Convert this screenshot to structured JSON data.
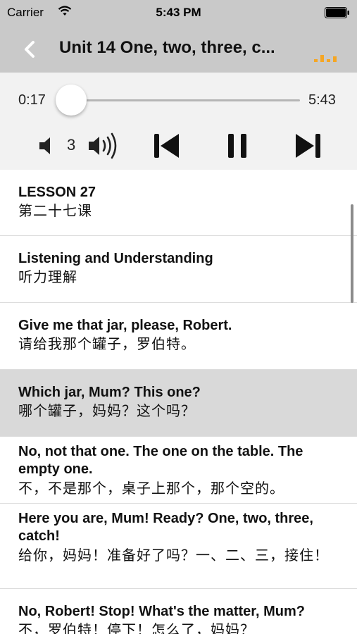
{
  "status_bar": {
    "carrier": "Carrier",
    "time": "5:43 PM"
  },
  "nav": {
    "title": "Unit 14 One, two, three, c...",
    "accent_color": "#f5a623"
  },
  "player": {
    "elapsed": "0:17",
    "duration": "5:43",
    "progress_fraction": 0.05,
    "volume_level": "3",
    "accent_color": "#1a8de6"
  },
  "lessons": [
    {
      "en": "LESSON 27",
      "zh": "第二十七课",
      "selected": false
    },
    {
      "en": "Listening and Understanding",
      "zh": "听力理解",
      "selected": false
    },
    {
      "en": "Give me that jar, please, Robert.",
      "zh": "请给我那个罐子，罗伯特。",
      "selected": false
    },
    {
      "en": "Which jar, Mum? This one?",
      "zh": "哪个罐子，妈妈？这个吗？",
      "selected": true
    },
    {
      "en": "No, not that one. The one on the table. The empty one.",
      "zh": "不，不是那个，桌子上那个，那个空的。",
      "selected": false
    },
    {
      "en": "Here you are, Mum! Ready? One, two, three, catch!",
      "zh": "给你，妈妈！准备好了吗？一、二、三，接住！",
      "selected": false
    },
    {
      "en": "No, Robert! Stop! What's the matter, Mum?",
      "zh": "不，罗伯特！停下！怎么了，妈妈？",
      "selected": false
    }
  ]
}
